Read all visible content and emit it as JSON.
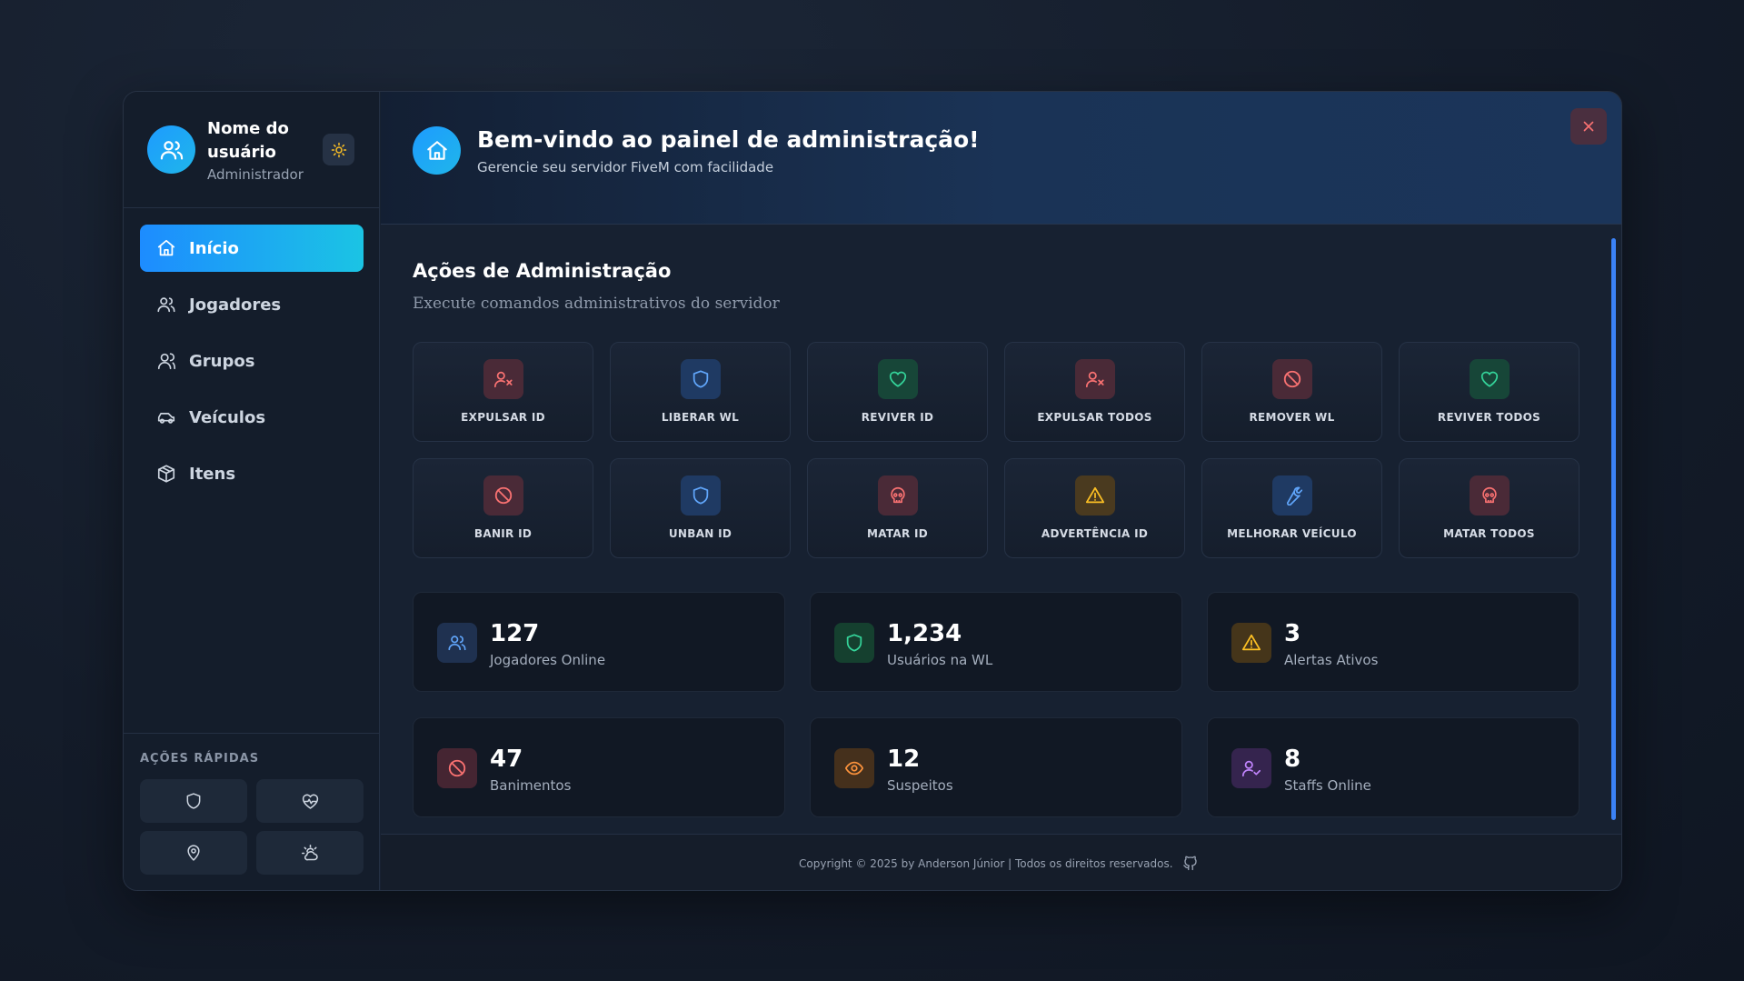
{
  "user": {
    "name": "Nome do usuário",
    "role": "Administrador"
  },
  "nav": [
    {
      "label": "Início",
      "icon": "home-icon",
      "active": true
    },
    {
      "label": "Jogadores",
      "icon": "users-icon"
    },
    {
      "label": "Grupos",
      "icon": "group-icon"
    },
    {
      "label": "Veículos",
      "icon": "car-icon"
    },
    {
      "label": "Itens",
      "icon": "box-icon"
    }
  ],
  "quick_actions": {
    "title": "AÇÕES RÁPIDAS",
    "items": [
      "shield-icon",
      "heart-pulse-icon",
      "map-pin-icon",
      "weather-icon"
    ]
  },
  "header": {
    "title": "Bem-vindo ao painel de administração!",
    "subtitle": "Gerencie seu servidor FiveM com facilidade"
  },
  "actions_section": {
    "title": "Ações de Administração",
    "subtitle": "Execute comandos administrativos do servidor"
  },
  "actions": [
    {
      "label": "EXPULSAR ID",
      "icon": "user-x-icon",
      "color": "#f87171"
    },
    {
      "label": "LIBERAR WL",
      "icon": "shield-icon",
      "color": "#60a5fa"
    },
    {
      "label": "REVIVER ID",
      "icon": "heart-icon",
      "color": "#34d399"
    },
    {
      "label": "EXPULSAR TODOS",
      "icon": "user-x-icon",
      "color": "#f87171"
    },
    {
      "label": "REMOVER WL",
      "icon": "ban-icon",
      "color": "#f87171"
    },
    {
      "label": "REVIVER TODOS",
      "icon": "heart-icon",
      "color": "#34d399"
    },
    {
      "label": "BANIR ID",
      "icon": "ban-icon",
      "color": "#f87171"
    },
    {
      "label": "UNBAN ID",
      "icon": "shield-icon",
      "color": "#60a5fa"
    },
    {
      "label": "MATAR ID",
      "icon": "skull-icon",
      "color": "#f87171"
    },
    {
      "label": "ADVERTÊNCIA ID",
      "icon": "warning-icon",
      "color": "#fbbf24"
    },
    {
      "label": "MELHORAR VEÍCULO",
      "icon": "wrench-icon",
      "color": "#60a5fa"
    },
    {
      "label": "MATAR TODOS",
      "icon": "skull-icon",
      "color": "#f87171"
    }
  ],
  "stats": [
    {
      "value": "127",
      "label": "Jogadores Online",
      "icon": "users-icon",
      "color": "#60a5fa"
    },
    {
      "value": "1,234",
      "label": "Usuários na WL",
      "icon": "shield-icon",
      "color": "#34d399"
    },
    {
      "value": "3",
      "label": "Alertas Ativos",
      "icon": "warning-icon",
      "color": "#fbbf24"
    },
    {
      "value": "47",
      "label": "Banimentos",
      "icon": "ban-icon",
      "color": "#f87171"
    },
    {
      "value": "12",
      "label": "Suspeitos",
      "icon": "eye-icon",
      "color": "#fb923c"
    },
    {
      "value": "8",
      "label": "Staffs Online",
      "icon": "user-check-icon",
      "color": "#c084fc"
    }
  ],
  "footer": {
    "copyright": "Copyright © 2025 by Anderson Júnior | Todos os direitos reservados."
  }
}
